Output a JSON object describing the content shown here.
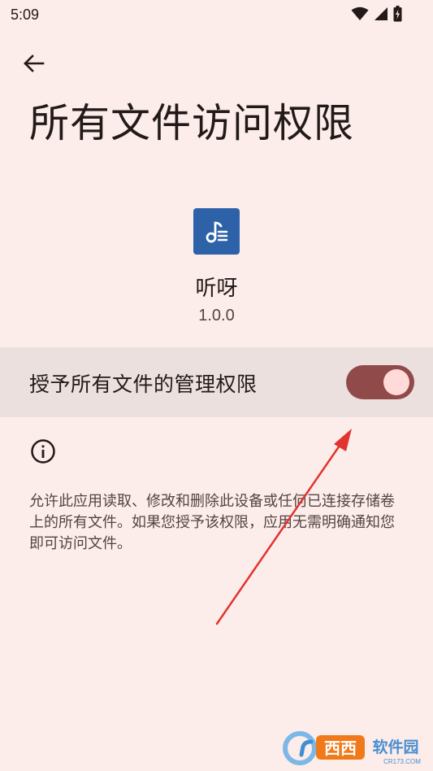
{
  "status_bar": {
    "time": "5:09",
    "icons": [
      "wifi-icon",
      "signal-icon",
      "battery-icon"
    ]
  },
  "header": {
    "back_icon": "back-arrow-icon",
    "title": "所有文件访问权限"
  },
  "app": {
    "icon": "music-note-icon",
    "name": "听呀",
    "version": "1.0.0"
  },
  "permission": {
    "label": "授予所有文件的管理权限",
    "enabled": true
  },
  "info": {
    "icon": "info-icon",
    "description": "允许此应用读取、修改和删除此设备或任何已连接存储卷上的所有文件。如果您授予该权限，应用无需明确通知您即可访问文件。"
  },
  "watermark": {
    "text": "西西软件园",
    "subtext": "CR173.COM"
  },
  "colors": {
    "background": "#fcecea",
    "row_background": "#ebe0de",
    "switch_track": "#904a49",
    "switch_thumb": "#ffdad8",
    "app_icon": "#2d62a8",
    "arrow": "#e0342f"
  }
}
